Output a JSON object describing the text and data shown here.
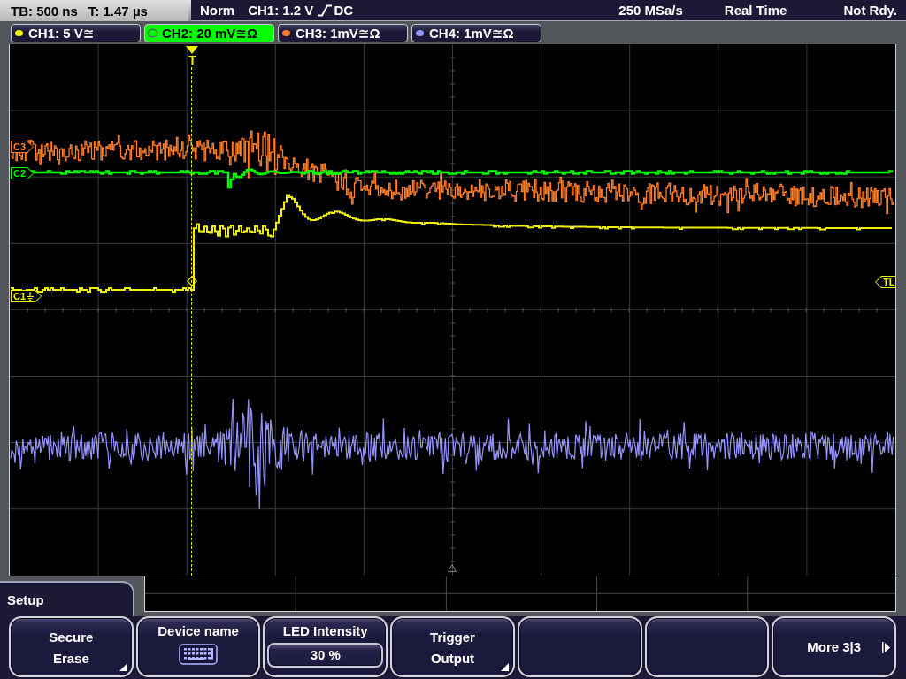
{
  "status_bar": {
    "timebase": "TB: 500 ns",
    "trigger_time": "T: 1.47 µs",
    "trigger_mode": "Norm",
    "trigger_source": "CH1: 1.2 V",
    "trigger_coupling": "DC",
    "sample_rate": "250 MSa/s",
    "acquisition": "Real Time",
    "status": "Not Rdy."
  },
  "channels": [
    {
      "label": "CH1: 5 V≅",
      "color": "#f0f000",
      "selected": false
    },
    {
      "label": "CH2: 20 mV≅Ω",
      "color": "#00ff00",
      "selected": true
    },
    {
      "label": "CH3: 1mV≅Ω",
      "color": "#ff7f2a",
      "selected": false
    },
    {
      "label": "CH4: 1mV≅Ω",
      "color": "#9494ff",
      "selected": false
    }
  ],
  "display": {
    "channel_markers": [
      {
        "label": "C3",
        "color": "#ff7f2a",
        "kind": "plain"
      },
      {
        "label": "C2",
        "color": "#00ff00",
        "kind": "plain"
      },
      {
        "label": "C1",
        "color": "#f0f000",
        "kind": "ground"
      }
    ],
    "trigger_marker": {
      "label": "T"
    },
    "trigger_level_marker": {
      "label": "TL"
    }
  },
  "menu": {
    "title": "Setup",
    "soft_keys": [
      {
        "kind": "submenu",
        "lines": [
          "Secure",
          "Erase"
        ]
      },
      {
        "kind": "keyboard",
        "label": "Device name"
      },
      {
        "kind": "value",
        "label": "LED Intensity",
        "value": "30 %"
      },
      {
        "kind": "submenu",
        "lines": [
          "Trigger",
          "Output"
        ]
      },
      {
        "kind": "blank"
      },
      {
        "kind": "blank"
      },
      {
        "kind": "next",
        "label": "More 3|3"
      }
    ]
  }
}
